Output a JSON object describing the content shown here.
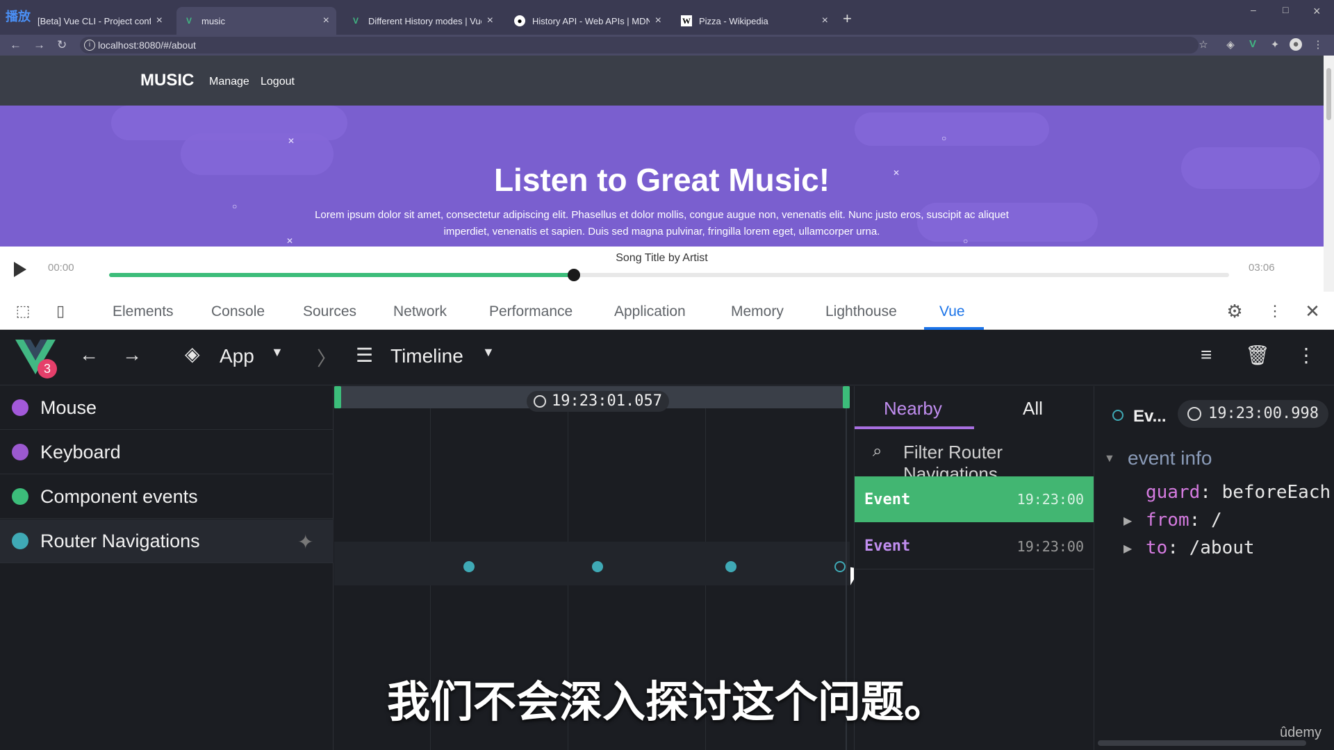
{
  "browser": {
    "tabs": [
      {
        "label": "[Beta] Vue CLI - Project configura",
        "icon": "vue-icon"
      },
      {
        "label": "music",
        "icon": "vue-icon"
      },
      {
        "label": "Different History modes | Vue Ro",
        "icon": "vue-icon"
      },
      {
        "label": "History API - Web APIs | MDN",
        "icon": "mdn-icon"
      },
      {
        "label": "Pizza - Wikipedia",
        "icon": "wikipedia-icon"
      }
    ],
    "watermark": "播放",
    "url": "localhost:8080/#/about"
  },
  "page": {
    "brand": "MUSIC",
    "nav": [
      "Manage",
      "Logout"
    ],
    "hero_title": "Listen to Great Music!",
    "hero_text": "Lorem ipsum dolor sit amet, consectetur adipiscing elit. Phasellus et dolor mollis, congue augue non, venenatis elit. Nunc justo eros, suscipit ac aliquet imperdiet, venenatis et sapien. Duis sed magna pulvinar, fringilla lorem eget, ullamcorper urna.",
    "player": {
      "current": "00:00",
      "duration": "03:06",
      "title": "Song Title by Artist",
      "progress": 0.415
    }
  },
  "devtools": {
    "tabs": [
      "Elements",
      "Console",
      "Sources",
      "Network",
      "Performance",
      "Application",
      "Memory",
      "Lighthouse",
      "Vue"
    ],
    "active_tab": "Vue",
    "vue": {
      "badge": "3",
      "app_label": "App",
      "timeline_label": "Timeline",
      "layers": [
        {
          "label": "Mouse",
          "color": "#a259d9"
        },
        {
          "label": "Keyboard",
          "color": "#9b59d0"
        },
        {
          "label": "Component events",
          "color": "#3cbd7a"
        },
        {
          "label": "Router Navigations",
          "color": "#3fa9b5"
        }
      ],
      "cursor_time": "19:23:01.057",
      "middle_tabs": [
        "Nearby",
        "All"
      ],
      "filter_placeholder": "Filter Router Navigations",
      "events": [
        {
          "name": "Event",
          "time": "19:23:00"
        },
        {
          "name": "Event",
          "time": "19:23:00"
        }
      ],
      "detail": {
        "header": "Ev...",
        "time": "19:23:00.998",
        "section": "event info",
        "guard_key": "guard",
        "guard_val": "beforeEach",
        "from_key": "from",
        "from_val": "/",
        "to_key": "to",
        "to_val": "/about"
      }
    }
  },
  "caption": "我们不会深入探讨这个问题。",
  "udemy": "ûdemy"
}
